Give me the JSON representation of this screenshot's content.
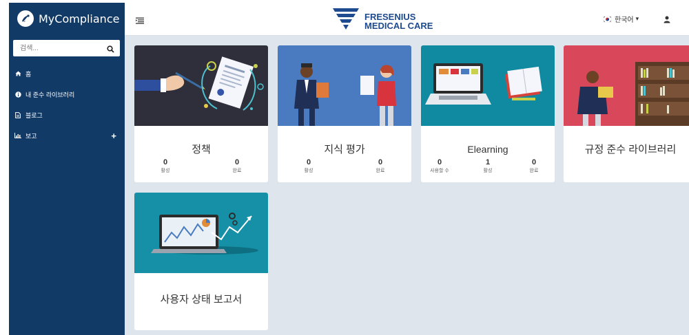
{
  "app": {
    "name": "MyCompliance"
  },
  "search": {
    "placeholder": "검색..."
  },
  "sidebar": {
    "items": [
      {
        "label": "홈",
        "icon": "home-icon"
      },
      {
        "label": "내 준수 라이브러리",
        "icon": "info-icon"
      },
      {
        "label": "블로그",
        "icon": "file-icon"
      },
      {
        "label": "보고",
        "icon": "bar-chart-icon",
        "expand": "+"
      }
    ]
  },
  "header": {
    "brand_line1": "FRESENIUS",
    "brand_line2": "MEDICAL CARE",
    "language": "한국어",
    "caret": "▾"
  },
  "cards": [
    {
      "title": "정책",
      "stats": [
        {
          "value": "0",
          "label": "활성"
        },
        {
          "value": "0",
          "label": "완료"
        }
      ]
    },
    {
      "title": "지식 평가",
      "stats": [
        {
          "value": "0",
          "label": "활성"
        },
        {
          "value": "0",
          "label": "완료"
        }
      ]
    },
    {
      "title": "Elearning",
      "stats": [
        {
          "value": "0",
          "label": "사용할 수"
        },
        {
          "value": "1",
          "label": "활성"
        },
        {
          "value": "0",
          "label": "완료"
        }
      ]
    },
    {
      "title": "규정 준수 라이브러리",
      "stats": []
    },
    {
      "title": "사용자 상태 보고서",
      "stats": []
    }
  ],
  "colors": {
    "sidebar": "#123a67",
    "brand_blue": "#1e4a8f",
    "content_bg": "#dfe5ec",
    "policy_bg": "#2e2f3b",
    "assessment_bg": "#4a7abf",
    "elearning_bg": "#0f8aa0",
    "library_bg": "#d9475a",
    "report_bg": "#1690a6"
  }
}
